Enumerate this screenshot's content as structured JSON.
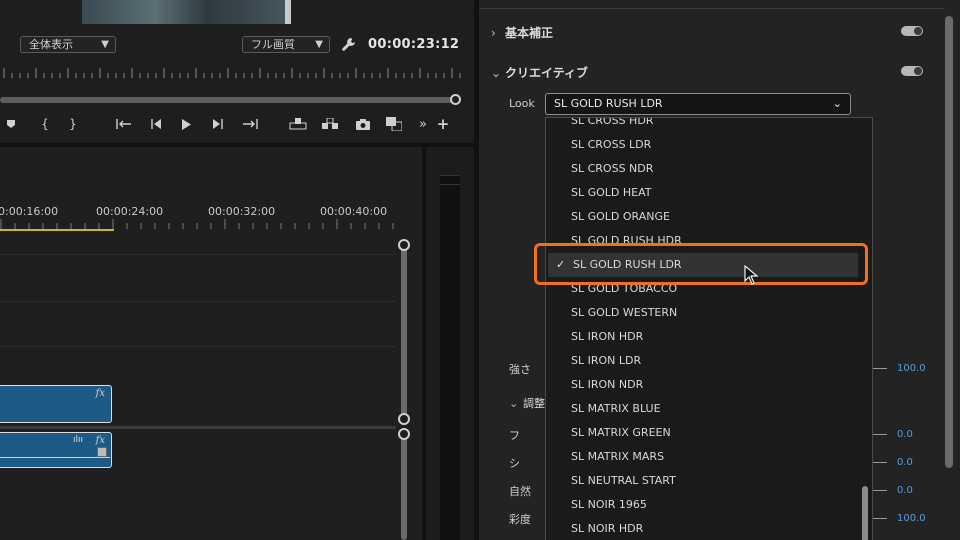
{
  "monitor": {
    "fit_label": "全体表示",
    "quality_label": "フル画質",
    "timecode": "00:00:23:12"
  },
  "timeline": {
    "ruler_labels": [
      "0:00:16:00",
      "00:00:24:00",
      "00:00:32:00",
      "00:00:40:00"
    ],
    "fx_badge": "fx"
  },
  "lumetri": {
    "basic_correction": "基本補正",
    "creative": "クリエイティブ",
    "look_label": "Look",
    "look_selected": "SL GOLD RUSH LDR",
    "intensity_label": "強さ",
    "intensity_value": "100.0",
    "adjust_label": "調整",
    "adjust_rows": [
      {
        "label": "フ",
        "value": "0.0"
      },
      {
        "label": "シ",
        "value": "0.0"
      },
      {
        "label": "自然",
        "value": "0.0"
      },
      {
        "label": "彩度",
        "value": "100.0"
      }
    ]
  },
  "look_options": [
    "SL CROSS HDR",
    "SL CROSS LDR",
    "SL CROSS NDR",
    "SL GOLD HEAT",
    "SL GOLD ORANGE",
    "SL GOLD RUSH HDR",
    "SL GOLD RUSH LDR",
    "SL GOLD TOBACCO",
    "SL GOLD WESTERN",
    "SL IRON HDR",
    "SL IRON LDR",
    "SL IRON NDR",
    "SL MATRIX BLUE",
    "SL MATRIX GREEN",
    "SL MATRIX MARS",
    "SL NEUTRAL START",
    "SL NOIR 1965",
    "SL NOIR HDR"
  ],
  "selected_option_index": 6,
  "check_glyph": "✓",
  "colors": {
    "accent_highlight": "#f0701e",
    "clip_blue": "#1f5a87",
    "value_blue": "#5c9bd6",
    "work_area_yellow": "#c9b432"
  }
}
